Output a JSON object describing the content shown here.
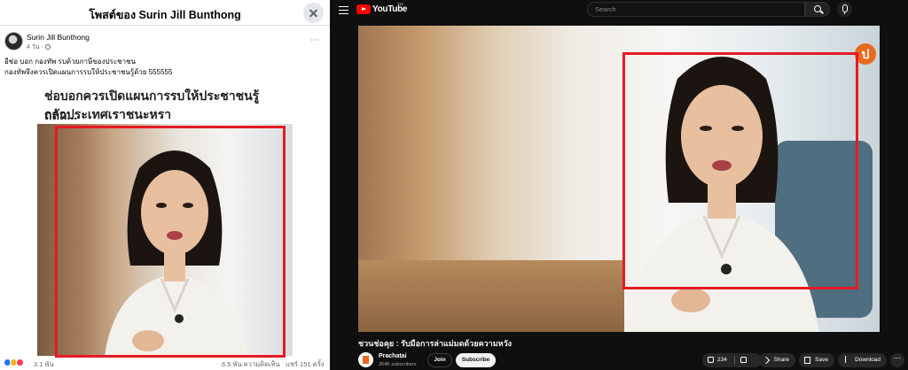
{
  "facebook": {
    "header_title": "โพสต์ของ Surin Jill Bunthong",
    "author": "Surin Jill Bunthong",
    "time": "4 วัน ·",
    "text_line1": "อีช่อ บอก กองทัพ รบด้วยภาษีของประชาชน",
    "text_line2": "กองทัพจึงควรเปิดแผนการรบให้ประชาชนรู้ด้วย 555555",
    "shared_headline_line1": "ช่อบอกควรเปิดแผนการรบให้ประชาชนรู้ ถถถ...",
    "shared_headline_line2": "กลัวประเทศเราชนะหรา",
    "more_icon": "⋯",
    "reactions_count": "3.1 พัน",
    "comments_count": "6.5 พัน ความคิดเห็น",
    "shares_count": "แชร์ 151 ครั้ง",
    "reaction_colors": [
      "#1877f2",
      "#f7b125",
      "#f33e58"
    ]
  },
  "youtube": {
    "logo_text": "YouTube",
    "logo_sup": "TH",
    "search_placeholder": "Search",
    "video_title": "ชวนช่อคุย : รับมือการล่าแม่มดด้วยความหวัง",
    "channel_name": "Prachatai",
    "subscribers": "264K subscribers",
    "join_label": "Join",
    "subscribe_label": "Subscribe",
    "like_count": "234",
    "share_label": "Share",
    "save_label": "Save",
    "download_label": "Download",
    "overflow_icon": "⋯",
    "watermark_letter": "ป"
  },
  "accent_color": "#e41b23"
}
